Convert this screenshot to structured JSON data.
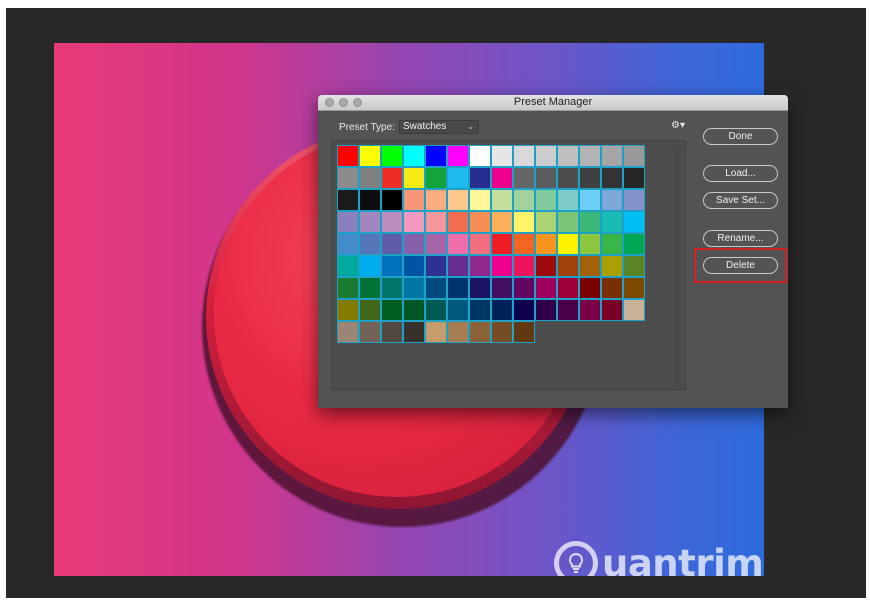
{
  "dialog": {
    "title": "Preset Manager",
    "preset_type_label": "Preset Type:",
    "preset_type_value": "Swatches",
    "buttons": {
      "done": "Done",
      "load": "Load...",
      "save_set": "Save Set...",
      "rename": "Rename...",
      "delete": "Delete"
    },
    "highlighted_button": "Delete"
  },
  "watermark": {
    "text": "uantrimang"
  },
  "icons": {
    "menu": "gear-icon",
    "dropdown": "chevron-down-icon",
    "watermark_logo": "lightbulb-icon"
  },
  "swatches": [
    "#ff0000",
    "#ffff00",
    "#00ff00",
    "#00ffff",
    "#0000ff",
    "#ff00ff",
    "#ffffff",
    "#e6e6e6",
    "#d9d9d9",
    "#cccccc",
    "#bfbfbf",
    "#b3b3b3",
    "#a6a6a6",
    "#999999",
    "#8c8c8c",
    "#808080",
    "#ee2d24",
    "#f6ea16",
    "#13a53c",
    "#1ebbee",
    "#262e8f",
    "#ec008c",
    "#666666",
    "#5c5c5c",
    "#4d4d4d",
    "#404040",
    "#333333",
    "#262626",
    "#1a1a1a",
    "#0d0d0d",
    "#000000",
    "#f7977a",
    "#f9ad81",
    "#fdc68a",
    "#fff79a",
    "#c4df9b",
    "#a2d39c",
    "#82ca9d",
    "#7bcdc8",
    "#6dcff6",
    "#7da7d9",
    "#8393ca",
    "#8781bd",
    "#a187be",
    "#bc8cbf",
    "#f49ac1",
    "#f5989d",
    "#f26c4f",
    "#f68e55",
    "#fbaf5c",
    "#fff467",
    "#acd372",
    "#7cc576",
    "#3bb878",
    "#1abbb4",
    "#00bff3",
    "#438ccb",
    "#5574b9",
    "#605ca8",
    "#855fa8",
    "#a763a8",
    "#f06ea9",
    "#f26d7d",
    "#ed1c24",
    "#f26522",
    "#f7941d",
    "#fff200",
    "#8dc63f",
    "#39b54a",
    "#00a651",
    "#00a99d",
    "#00aeef",
    "#0072bc",
    "#0054a6",
    "#2e3192",
    "#662d91",
    "#92278f",
    "#ec008c",
    "#ed145b",
    "#9e0b0f",
    "#a0410d",
    "#a36209",
    "#aba000",
    "#598527",
    "#1a7b30",
    "#007236",
    "#00746b",
    "#0076a3",
    "#004b80",
    "#003471",
    "#1b1464",
    "#440e62",
    "#630460",
    "#9e005d",
    "#9e0039",
    "#790000",
    "#7b2e00",
    "#7d4900",
    "#827b00",
    "#406618",
    "#005e20",
    "#005826",
    "#005952",
    "#005b7f",
    "#003663",
    "#002157",
    "#0d004c",
    "#32004b",
    "#4b0049",
    "#7b0046",
    "#7a0026",
    "#c7b299",
    "#998675",
    "#736357",
    "#534741",
    "#37302d",
    "#c69c6d",
    "#a67c52",
    "#8c6239",
    "#754c24",
    "#603913"
  ]
}
